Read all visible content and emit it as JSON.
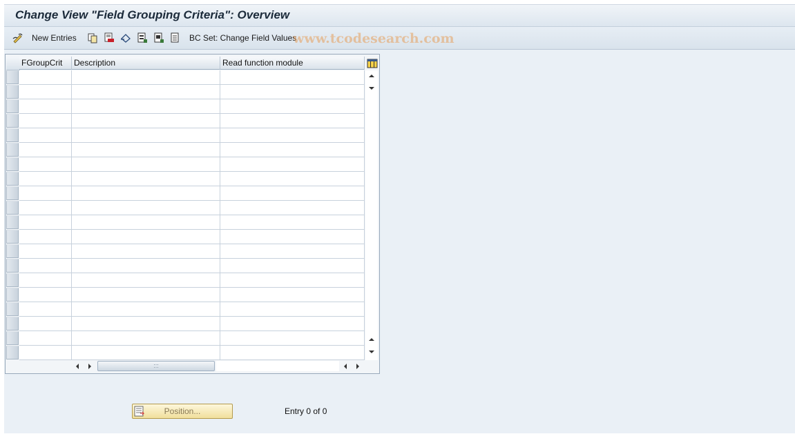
{
  "title": "Change View \"Field Grouping Criteria\": Overview",
  "watermark": "www.tcodesearch.com",
  "toolbar": {
    "new_entries_label": "New Entries",
    "bc_set_label": "BC Set: Change Field Values",
    "icons": [
      "glasses-pencil-icon",
      "copy-icon",
      "delete-icon",
      "undo-icon",
      "select-all-icon",
      "select-block-icon",
      "deselect-all-icon"
    ]
  },
  "table": {
    "columns": [
      {
        "label": "FGroupCrit"
      },
      {
        "label": "Description"
      },
      {
        "label": "Read function module"
      }
    ],
    "rows": [
      [
        "",
        "",
        ""
      ],
      [
        "",
        "",
        ""
      ],
      [
        "",
        "",
        ""
      ],
      [
        "",
        "",
        ""
      ],
      [
        "",
        "",
        ""
      ],
      [
        "",
        "",
        ""
      ],
      [
        "",
        "",
        ""
      ],
      [
        "",
        "",
        ""
      ],
      [
        "",
        "",
        ""
      ],
      [
        "",
        "",
        ""
      ],
      [
        "",
        "",
        ""
      ],
      [
        "",
        "",
        ""
      ],
      [
        "",
        "",
        ""
      ],
      [
        "",
        "",
        ""
      ],
      [
        "",
        "",
        ""
      ],
      [
        "",
        "",
        ""
      ],
      [
        "",
        "",
        ""
      ],
      [
        "",
        "",
        ""
      ],
      [
        "",
        "",
        ""
      ],
      [
        "",
        "",
        ""
      ]
    ]
  },
  "footer": {
    "position_label": "Position...",
    "entry_text": "Entry 0 of 0"
  },
  "colors": {
    "background": "#eaf0f6",
    "button_fill": "#f1df9c",
    "watermark": "#e7a05c"
  }
}
